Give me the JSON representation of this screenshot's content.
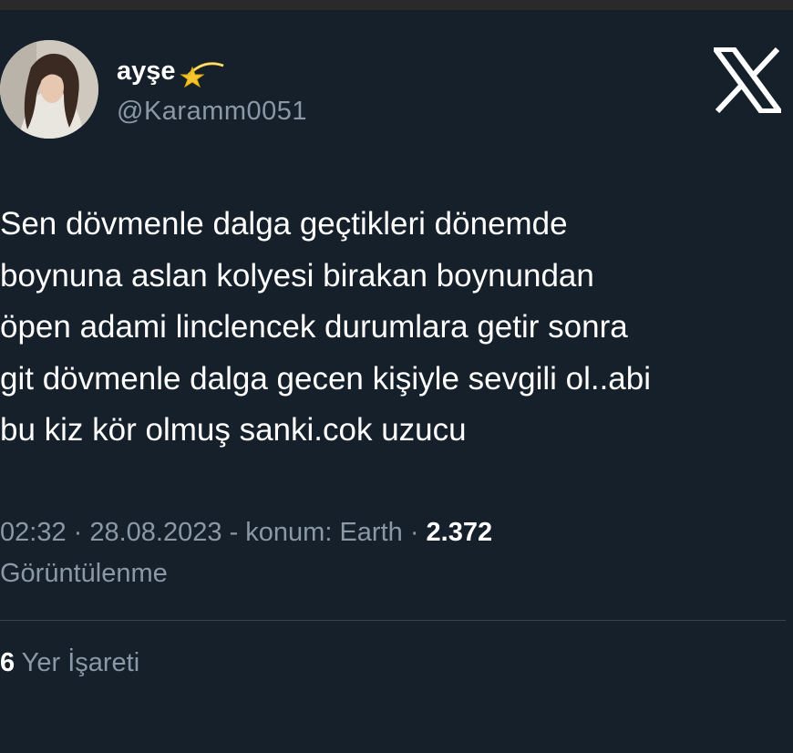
{
  "tweet": {
    "author": {
      "name": "ayşe",
      "handle": "@Karamm0051",
      "avatar": "profile-photo",
      "name_emoji": "dizzy-star-icon"
    },
    "logo": "x-logo-icon",
    "text_lines": [
      "Sen dövmenle dalga geçtikleri dönemde",
      "boynuna aslan kolyesi birakan boynundan",
      "öpen adami linclencek durumlara getir sonra",
      "git dövmenle dalga gecen kişiyle sevgili ol..abi",
      "bu kiz kör olmuş sanki.cok uzucu"
    ],
    "meta": {
      "time": "02:32",
      "sep1": " · ",
      "date": "28.08.2023",
      "location": " - konum: Earth",
      "sep2": " · ",
      "views_count": "2.372",
      "views_label": "Görüntülenme"
    },
    "bookmarks": {
      "count": "6",
      "label": " Yer İşareti"
    }
  },
  "colors": {
    "background": "#15202b",
    "text_primary": "#ffffff",
    "text_secondary": "#8b98a5",
    "divider": "#38444d",
    "star": "#f4c430"
  }
}
